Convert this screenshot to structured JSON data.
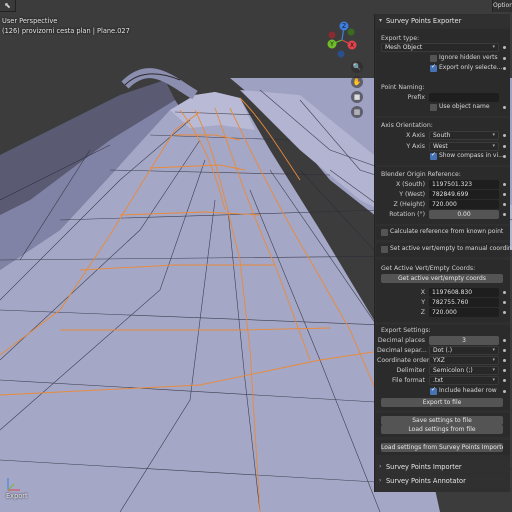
{
  "viewport": {
    "title": "User Perspective",
    "subtitle": "(126) provizorni cesta plan | Plane.027",
    "corner_label": "Export",
    "options_label": "Options",
    "gizmo": {
      "x": "X",
      "y": "Y",
      "z": "Z"
    }
  },
  "panel": {
    "title": "Survey Points Exporter",
    "export_type": {
      "label": "Export type:",
      "value": "Mesh Object",
      "ignore_hidden": "Ignore hidden verts",
      "ignore_hidden_checked": false,
      "export_only_selected": "Export only selecte...",
      "export_only_selected_checked": true
    },
    "point_naming": {
      "label": "Point Naming:",
      "prefix_label": "Prefix",
      "prefix_value": "",
      "use_object_name": "Use object name",
      "use_object_name_checked": false
    },
    "axis_orientation": {
      "label": "Axis Orientation:",
      "x_label": "X Axis",
      "x_value": "South",
      "y_label": "Y Axis",
      "y_value": "West",
      "show_compass": "Show compass in vi...",
      "show_compass_checked": true
    },
    "origin_reference": {
      "label": "Blender Origin Reference:",
      "x_label": "X (South)",
      "x_value": "1197501.323",
      "y_label": "Y (West)",
      "y_value": "782849.699",
      "z_label": "Z (Height)",
      "z_value": "720.000",
      "rotation_label": "Rotation (°)",
      "rotation_value": "0.00"
    },
    "calculate_reference": "Calculate reference from known point",
    "set_active_vert": "Set active vert/empty to manual coordinates",
    "active_coords": {
      "label": "Get Active Vert/Empty Coords:",
      "button": "Get active vert/empty coords",
      "x_label": "X",
      "x_value": "1197608.830",
      "y_label": "Y",
      "y_value": "782755.760",
      "z_label": "Z",
      "z_value": "720.000"
    },
    "export_settings": {
      "label": "Export Settings:",
      "decimal_places_label": "Decimal places",
      "decimal_places_value": "3",
      "decimal_sep_label": "Decimal separ...",
      "decimal_sep_value": "Dot (.)",
      "coord_order_label": "Coordinate order",
      "coord_order_value": "YXZ",
      "delimiter_label": "Delimiter",
      "delimiter_value": "Semicolon (;)",
      "file_format_label": "File format",
      "file_format_value": ".txt",
      "include_header": "Include header row",
      "include_header_checked": true,
      "export_button": "Export to file"
    },
    "save_settings": "Save settings to file",
    "load_settings": "Load settings from file",
    "load_from_importer": "Load settings from Survey Points Importer"
  },
  "collapsed_panels": [
    {
      "title": "Survey Points Importer"
    },
    {
      "title": "Survey Points Annotator"
    }
  ],
  "colors": {
    "mesh": "#a7a9c8",
    "selected_edge": "#e98a38",
    "checkbox_on": "#4772b3",
    "axis_x": "#e0434c",
    "axis_y": "#6fbc2b",
    "axis_z": "#3d7fe0"
  }
}
